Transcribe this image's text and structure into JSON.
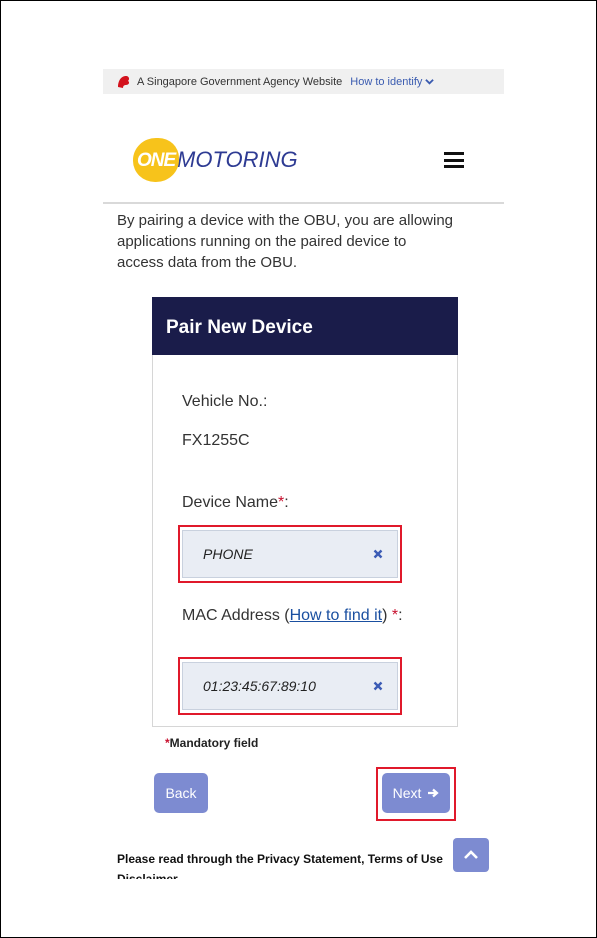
{
  "gov_banner": {
    "text": "A Singapore Government Agency Website",
    "link": "How to identify"
  },
  "header": {
    "logo_one": "ONE",
    "logo_motoring": "MOTORING"
  },
  "intro": "By pairing a device with the OBU, you are allowing applications running on the paired device to access data from the OBU.",
  "form": {
    "title": "Pair New Device",
    "vehicle_label": "Vehicle No.:",
    "vehicle_value": "FX1255C",
    "device_name_label": "Device Name",
    "device_name_value": "PHONE",
    "mac_label_prefix": "MAC Address (",
    "mac_link": "How to find it",
    "mac_label_suffix": ")",
    "mac_value": "01:23:45:67:89:10",
    "required_mark": "*",
    "colon": ":"
  },
  "mandatory": {
    "mark": "*",
    "text": "Mandatory field"
  },
  "buttons": {
    "back": "Back",
    "next": "Next"
  },
  "privacy_text": "Please read through the Privacy Statement, Terms of Use Disclaimer",
  "colors": {
    "brand_navy": "#1a1c4a",
    "button": "#7d8bd1",
    "highlight": "#e0192b",
    "logo_yellow": "#f7c31b",
    "logo_blue": "#2e3b93"
  },
  "icons": {
    "lion": "lion-head-icon",
    "chevron": "chevron-down-icon",
    "menu": "hamburger-menu-icon",
    "clear": "clear-x-icon",
    "next_arrow": "arrow-right-icon",
    "top": "chevron-up-icon"
  }
}
